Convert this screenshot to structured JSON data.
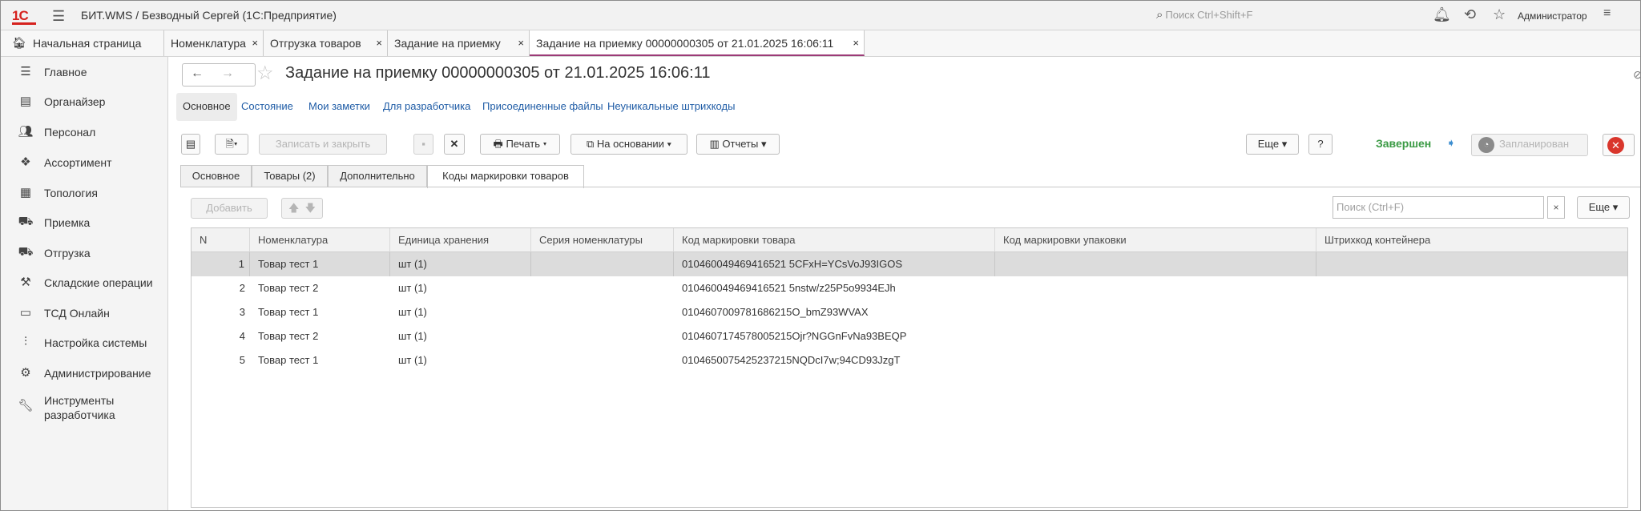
{
  "titlebar": {
    "logo": "1С",
    "title": "БИТ.WMS / Безводный Сергей  (1С:Предприятие)",
    "search_placeholder": "Поиск Ctrl+Shift+F",
    "user": "Администратор"
  },
  "tabs": [
    {
      "label": "Начальная страница"
    },
    {
      "label": "Номенклатура"
    },
    {
      "label": "Отгрузка товаров"
    },
    {
      "label": "Задание на приемку"
    },
    {
      "label": "Задание на приемку 00000000305 от 21.01.2025 16:06:11"
    }
  ],
  "sidebar": {
    "items": [
      {
        "label": "Главное"
      },
      {
        "label": "Органайзер"
      },
      {
        "label": "Персонал"
      },
      {
        "label": "Ассортимент"
      },
      {
        "label": "Топология"
      },
      {
        "label": "Приемка"
      },
      {
        "label": "Отгрузка"
      },
      {
        "label": "Складские операции"
      },
      {
        "label": "ТСД Онлайн"
      },
      {
        "label": "Настройка системы"
      },
      {
        "label": "Администрирование"
      },
      {
        "label": "Инструменты разработчика"
      }
    ]
  },
  "form": {
    "title": "Задание на приемку 00000000305 от 21.01.2025 16:06:11",
    "links": [
      "Основное",
      "Состояние",
      "Мои заметки",
      "Для разработчика",
      "Присоединенные файлы",
      "Неуникальные штрихкоды"
    ]
  },
  "toolbar": {
    "save_close": "Записать и закрыть",
    "print": "Печать",
    "based_on": "На основании",
    "reports": "Отчеты",
    "more": "Еще",
    "help": "?",
    "status": "Завершен",
    "planned": "Запланирован"
  },
  "inner_tabs": [
    "Основное",
    "Товары (2)",
    "Дополнительно",
    "Коды маркировки товаров"
  ],
  "table_toolbar": {
    "add": "Добавить",
    "search_placeholder": "Поиск (Ctrl+F)",
    "clear": "×",
    "more": "Еще"
  },
  "table": {
    "columns": [
      "N",
      "Номенклатура",
      "Единица хранения",
      "Серия номенклатуры",
      "Код маркировки товара",
      "Код маркировки упаковки",
      "Штрихкод контейнера"
    ],
    "rows": [
      {
        "n": "1",
        "item": "Товар тест 1",
        "unit": "шт (1)",
        "series": "",
        "code": "010460049469416521 5CFxH=YCsVoJ93IGOS",
        "pack": "",
        "container": ""
      },
      {
        "n": "2",
        "item": "Товар тест 2",
        "unit": "шт (1)",
        "series": "",
        "code": "010460049469416521 5nstw/z25P5o9934EJh",
        "pack": "",
        "container": ""
      },
      {
        "n": "3",
        "item": "Товар тест 1",
        "unit": "шт (1)",
        "series": "",
        "code": "0104607009781686215O_bmZ93WVAX",
        "pack": "",
        "container": ""
      },
      {
        "n": "4",
        "item": "Товар тест 2",
        "unit": "шт (1)",
        "series": "",
        "code": "0104607174578005215Ojr?NGGnFvNa93BEQP",
        "pack": "",
        "container": ""
      },
      {
        "n": "5",
        "item": "Товар тест 1",
        "unit": "шт (1)",
        "series": "",
        "code": "0104650075425237215NQDcI7w;94CD93JzgT",
        "pack": "",
        "container": ""
      }
    ]
  }
}
